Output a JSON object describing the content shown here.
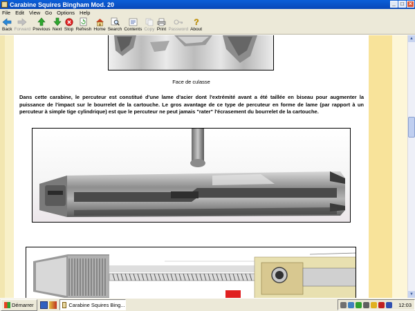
{
  "window": {
    "title": "Carabine Squires Bingham Mod. 20"
  },
  "menu": [
    "File",
    "Edit",
    "View",
    "Go",
    "Options",
    "Help"
  ],
  "toolbar": [
    {
      "label": "Back",
      "icon": "back-arrow-icon",
      "enabled": true
    },
    {
      "label": "Forward",
      "icon": "forward-arrow-icon",
      "enabled": false
    },
    {
      "label": "Previous",
      "icon": "up-arrow-icon",
      "enabled": true
    },
    {
      "label": "Next",
      "icon": "down-arrow-icon",
      "enabled": true
    },
    {
      "label": "Stop",
      "icon": "stop-icon",
      "enabled": true
    },
    {
      "label": "Refresh",
      "icon": "refresh-icon",
      "enabled": true
    },
    {
      "label": "Home",
      "icon": "home-icon",
      "enabled": true
    },
    {
      "label": "Search",
      "icon": "search-icon",
      "enabled": true
    },
    {
      "label": "Contents",
      "icon": "contents-icon",
      "enabled": true
    },
    {
      "label": "Copy",
      "icon": "copy-icon",
      "enabled": false
    },
    {
      "label": "Print",
      "icon": "print-icon",
      "enabled": true
    },
    {
      "label": "Password",
      "icon": "password-icon",
      "enabled": false
    },
    {
      "label": "About",
      "icon": "about-icon",
      "enabled": true
    }
  ],
  "page": {
    "caption": "Face de culasse",
    "paragraph": "Dans cette carabine, le percuteur est constitué d'une lame d'acier dont l'extrémité avant a été taillée en biseau pour augmenter la puissance de l'impact sur le bourrelet de la cartouche. Le gros avantage de ce type de percuteur en forme de lame (par rapport à un percuteur à simple tige cylindrique) est que le percuteur ne peut jamais \"rater\" l'écrasement du bourrelet de la cartouche."
  },
  "taskbar": {
    "start_label": "Démarrer",
    "task_label": "Carabine Squires Bing...",
    "clock": "12:03"
  },
  "colors": {
    "title_bar": "#0a5fd8",
    "page_band_left": "#f8f0c8",
    "page_band_right": "#f8e39a",
    "chrome": "#ece9d8"
  }
}
